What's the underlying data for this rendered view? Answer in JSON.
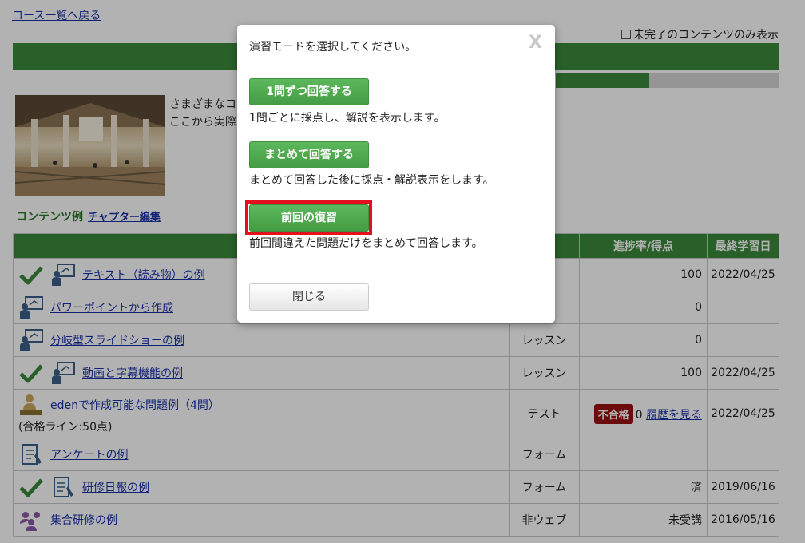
{
  "nav": {
    "back_link": "コース一覧へ戻る"
  },
  "filter": {
    "label": "未完了のコンテンツのみ表示",
    "checked": false
  },
  "course": {
    "progress_percent": 42,
    "description_lines": [
      "さまざまなコ",
      "ここから実際"
    ]
  },
  "section": {
    "title": "コンテンツ例",
    "edit_link": "チャプター編集"
  },
  "table": {
    "headers": {
      "name": "コ",
      "type": "",
      "progress": "進捗率/得点",
      "last_date": "最終学習日"
    },
    "rows": [
      {
        "name": "テキスト（読み物）の例",
        "type": "ン",
        "progress": "100",
        "date": "2022/04/25",
        "done": true,
        "icon": "lesson-icon"
      },
      {
        "name": "パワーポイントから作成",
        "type": "ン",
        "progress": "0",
        "date": "",
        "done": false,
        "icon": "lesson-icon"
      },
      {
        "name": "分岐型スライドショーの例",
        "type": "レッスン",
        "progress": "0",
        "date": "",
        "done": false,
        "icon": "lesson-icon"
      },
      {
        "name": "動画と字幕機能の例",
        "type": "レッスン",
        "progress": "100",
        "date": "2022/04/25",
        "done": true,
        "icon": "lesson-icon"
      },
      {
        "name": "edenで作成可能な問題例（4問）",
        "sub": "(合格ライン:50点)",
        "type": "テスト",
        "badge": "不合格",
        "score": "0",
        "history_link": "履歴を見る",
        "date": "2022/04/25",
        "done": false,
        "icon": "test-icon"
      },
      {
        "name": "アンケートの例",
        "type": "フォーム",
        "progress": "",
        "date": "",
        "done": false,
        "icon": "form-icon"
      },
      {
        "name": "研修日報の例",
        "type": "フォーム",
        "progress": "済",
        "date": "2019/06/16",
        "done": true,
        "icon": "form-icon"
      },
      {
        "name": "集合研修の例",
        "type": "非ウェブ",
        "progress": "未受講",
        "date": "2016/05/16",
        "done": false,
        "icon": "group-icon"
      }
    ]
  },
  "modal": {
    "title": "演習モードを選択してください。",
    "close_x": "X",
    "options": [
      {
        "label": "1問ずつ回答する",
        "description": "1問ごとに採点し、解説を表示します。"
      },
      {
        "label": "まとめて回答する",
        "description": "まとめて回答した後に採点・解説表示をします。"
      },
      {
        "label": "前回の復習",
        "description": "前回間違えた問題だけをまとめて回答します。"
      }
    ],
    "close_button": "閉じる"
  },
  "colors": {
    "accent_green": "#3c8a3c",
    "button_green": "#5cb85c",
    "fail_red": "#9b1010",
    "highlight_red": "#e3101d"
  }
}
